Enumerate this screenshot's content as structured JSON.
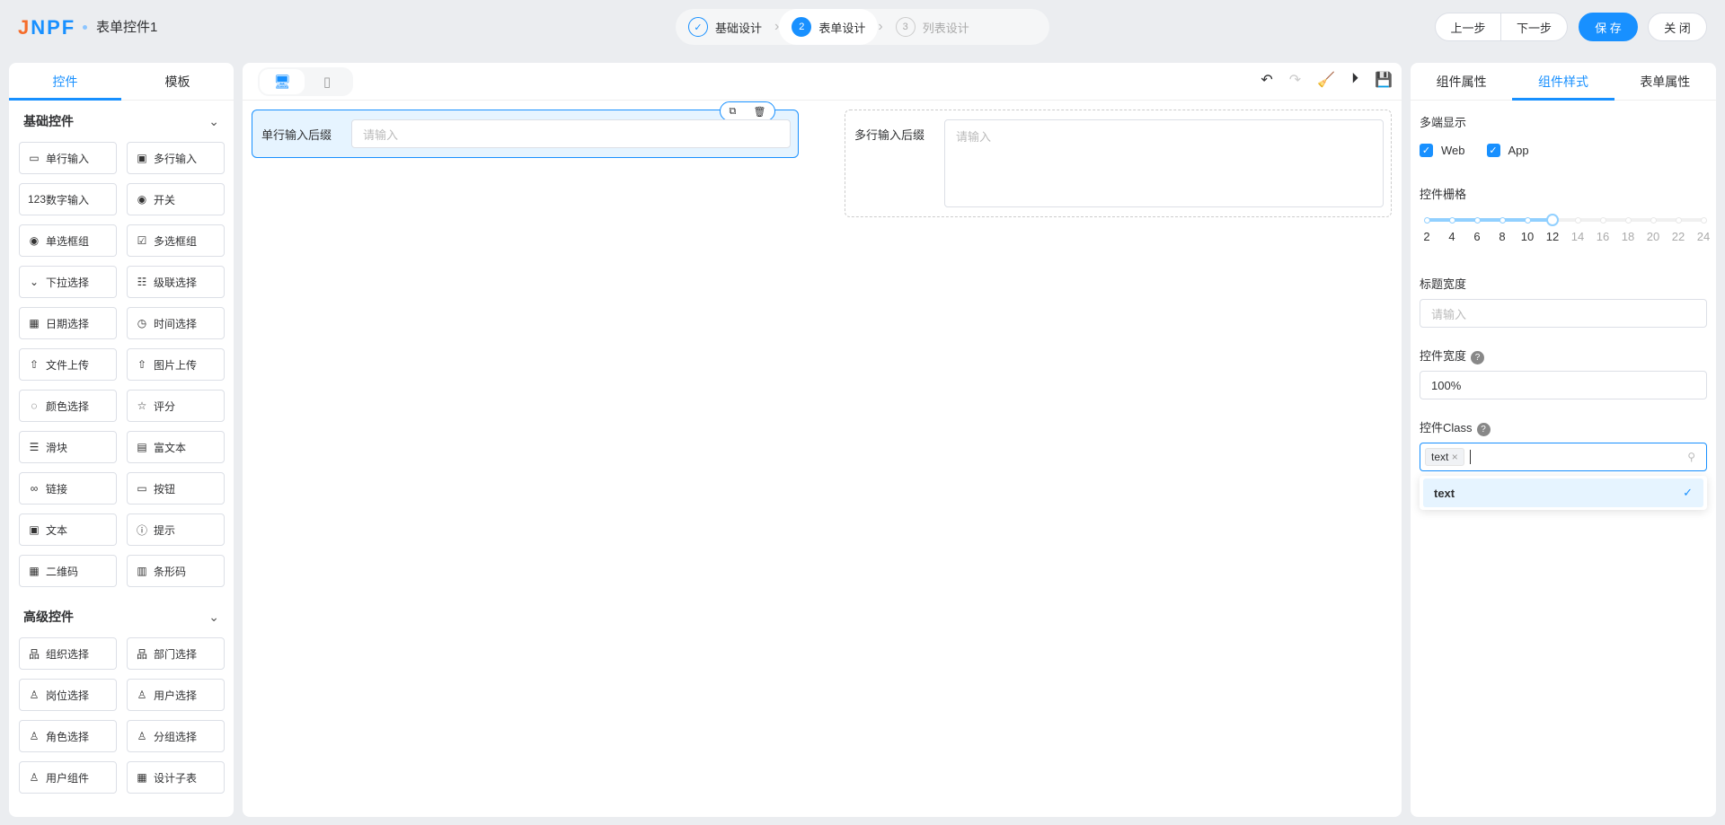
{
  "header": {
    "logo": "JNPF",
    "title": "表单控件1",
    "steps": [
      {
        "num": "✓",
        "label": "基础设计"
      },
      {
        "num": "2",
        "label": "表单设计"
      },
      {
        "num": "3",
        "label": "列表设计"
      }
    ],
    "prev": "上一步",
    "next": "下一步",
    "save": "保 存",
    "close": "关 闭"
  },
  "left": {
    "tabs": [
      "控件",
      "模板"
    ],
    "basic_title": "基础控件",
    "basic": [
      [
        "▭",
        "单行输入"
      ],
      [
        "▣",
        "多行输入"
      ],
      [
        "123",
        "数字输入"
      ],
      [
        "◉",
        "开关"
      ],
      [
        "◉",
        "单选框组"
      ],
      [
        "☑",
        "多选框组"
      ],
      [
        "⌄",
        "下拉选择"
      ],
      [
        "☷",
        "级联选择"
      ],
      [
        "▦",
        "日期选择"
      ],
      [
        "◷",
        "时间选择"
      ],
      [
        "⇧",
        "文件上传"
      ],
      [
        "⇧",
        "图片上传"
      ],
      [
        "◌",
        "颜色选择"
      ],
      [
        "☆",
        "评分"
      ],
      [
        "☰",
        "滑块"
      ],
      [
        "▤",
        "富文本"
      ],
      [
        "∞",
        "链接"
      ],
      [
        "▭",
        "按钮"
      ],
      [
        "▣",
        "文本"
      ],
      [
        "ⓘ",
        "提示"
      ],
      [
        "▦",
        "二维码"
      ],
      [
        "▥",
        "条形码"
      ]
    ],
    "adv_title": "高级控件",
    "advanced": [
      [
        "品",
        "组织选择"
      ],
      [
        "品",
        "部门选择"
      ],
      [
        "♙",
        "岗位选择"
      ],
      [
        "♙",
        "用户选择"
      ],
      [
        "♙",
        "角色选择"
      ],
      [
        "♙",
        "分组选择"
      ],
      [
        "♙",
        "用户组件"
      ],
      [
        "▦",
        "设计子表"
      ]
    ]
  },
  "canvas": {
    "field1_label": "单行输入后缀",
    "field1_placeholder": "请输入",
    "field2_label": "多行输入后缀",
    "field2_placeholder": "请输入"
  },
  "right": {
    "tabs": [
      "组件属性",
      "组件样式",
      "表单属性"
    ],
    "multi_label": "多端显示",
    "web": "Web",
    "app": "App",
    "grid_label": "控件栅格",
    "grid_ticks": [
      "2",
      "4",
      "6",
      "8",
      "10",
      "12",
      "14",
      "16",
      "18",
      "20",
      "22",
      "24"
    ],
    "grid_value": 12,
    "title_width_label": "标题宽度",
    "title_width_placeholder": "请输入",
    "width_label": "控件宽度",
    "width_value": "100%",
    "class_label": "控件Class",
    "class_tag": "text",
    "class_option": "text"
  }
}
